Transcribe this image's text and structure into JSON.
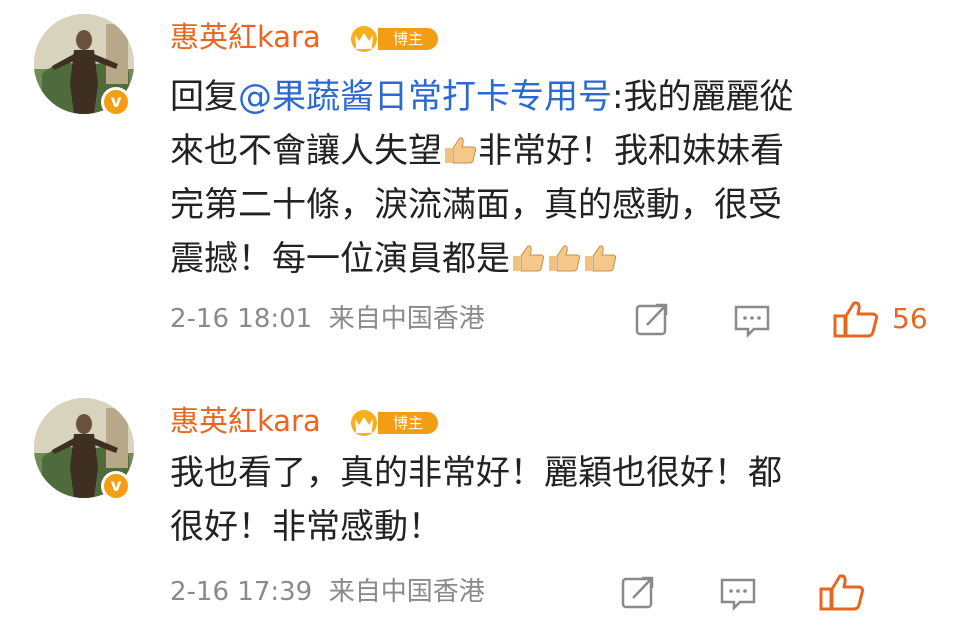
{
  "comments": [
    {
      "username": "惠英紅kara",
      "badge_label": "博主",
      "verified_mark": "v",
      "reply_prefix": "回复",
      "mention": "@果蔬酱日常打卡专用号",
      "text_1": ":我的麗麗從",
      "text_2": "來也不會讓人失望",
      "text_3": "非常好！我和妹妹看",
      "text_4": "完第二十條，淚流滿面，真的感動，很受",
      "text_5": "震撼！每一位演員都是",
      "timestamp": "2-16 18:01",
      "source": "来自中国香港",
      "like_count": "56",
      "icons": [
        "repost-icon",
        "comment-icon",
        "like-icon"
      ]
    },
    {
      "username": "惠英紅kara",
      "badge_label": "博主",
      "verified_mark": "v",
      "text_1": "我也看了，真的非常好！麗穎也很好！都",
      "text_2": "很好！非常感動！",
      "timestamp": "2-16 17:39",
      "source": "来自中国香港",
      "like_count": "",
      "icons": [
        "repost-icon",
        "comment-icon",
        "like-icon"
      ]
    }
  ],
  "colors": {
    "username": "#e8661f",
    "mention": "#2b6ad1",
    "badge": "#f39d14",
    "meta": "#8a8a8a",
    "like": "#e8661f"
  }
}
